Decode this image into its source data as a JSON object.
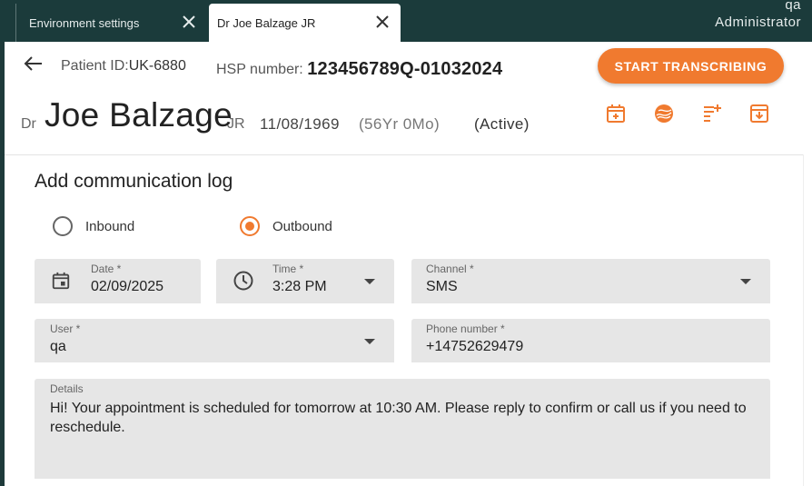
{
  "tabs": [
    {
      "label": "Environment settings"
    },
    {
      "label": "Dr Joe Balzage JR"
    }
  ],
  "user": {
    "name": "qa",
    "role": "Administrator"
  },
  "patient": {
    "id_label": "Patient ID:",
    "id_value": "UK-6880",
    "hsp_label": "HSP number:",
    "hsp_value": "123456789Q-01032024",
    "prefix": "Dr",
    "name": "Joe Balzage",
    "suffix": "JR",
    "dob": "11/08/1969",
    "age": "(56Yr 0Mo)",
    "status": "(Active)"
  },
  "actions": {
    "start_transcribing": "START TRANSCRIBING",
    "icons": [
      "calendar-add-icon",
      "globe-icon",
      "note-add-icon",
      "archive-download-icon"
    ]
  },
  "form": {
    "title": "Add communication log",
    "direction": {
      "options": [
        "Inbound",
        "Outbound"
      ],
      "selected": "Outbound"
    },
    "date": {
      "label": "Date *",
      "value": "02/09/2025"
    },
    "time": {
      "label": "Time *",
      "value": "3:28 PM"
    },
    "channel": {
      "label": "Channel *",
      "value": "SMS"
    },
    "user": {
      "label": "User *",
      "value": "qa"
    },
    "phone": {
      "label": "Phone number *",
      "value": "+14752629479"
    },
    "details": {
      "label": "Details",
      "value": "Hi! Your appointment is scheduled for tomorrow at 10:30 AM. Please reply to confirm or call us if you need to reschedule."
    }
  },
  "colors": {
    "topbar": "#1b3b3b",
    "accent": "#f07a2f",
    "field_bg": "#e6e6e6"
  }
}
